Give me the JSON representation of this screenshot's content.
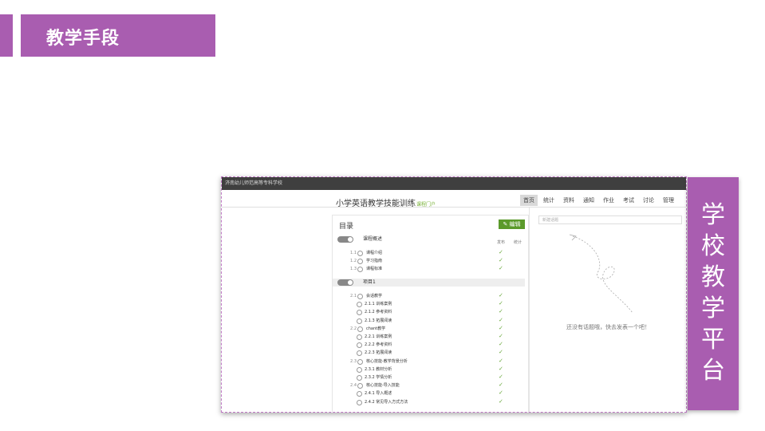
{
  "header": {
    "title": "教学手段"
  },
  "sidebar_card": {
    "text": "学\n校\n教\n学\n平\n台"
  },
  "screenshot": {
    "school": "济南幼儿师范高等专科学校",
    "course_title": "小学英语教学技能训练",
    "course_sub": "课程门户",
    "nav": [
      "首页",
      "统计",
      "资料",
      "通知",
      "作业",
      "考试",
      "讨论",
      "管理"
    ],
    "toc_title": "目录",
    "edit_label": "编辑",
    "col_study": "发布",
    "col_stat": "统计",
    "sections": [
      {
        "label": "课程概述"
      },
      {
        "label": "项目1"
      }
    ],
    "rows_sec1": [
      {
        "num": "1.1",
        "text": "课程介绍"
      },
      {
        "num": "1.2",
        "text": "学习指南"
      },
      {
        "num": "1.3",
        "text": "课程标准"
      }
    ],
    "rows_sec2": [
      {
        "num": "2.1",
        "text": "会话教学",
        "indent": 0
      },
      {
        "num": "",
        "text": "2.1.1 训练案例",
        "indent": 1
      },
      {
        "num": "",
        "text": "2.1.2 参考资料",
        "indent": 1
      },
      {
        "num": "",
        "text": "2.1.3 拓展阅读",
        "indent": 1
      },
      {
        "num": "2.2",
        "text": "chant教学",
        "indent": 0
      },
      {
        "num": "",
        "text": "2.2.1 训练案例",
        "indent": 1
      },
      {
        "num": "",
        "text": "2.2.2 参考资料",
        "indent": 1
      },
      {
        "num": "",
        "text": "2.2.3 拓展阅读",
        "indent": 1
      },
      {
        "num": "2.3",
        "text": "核心技能-教学背景分析",
        "indent": 0
      },
      {
        "num": "",
        "text": "2.3.1 教材分析",
        "indent": 1
      },
      {
        "num": "",
        "text": "2.3.2 学情分析",
        "indent": 1
      },
      {
        "num": "2.4",
        "text": "核心技能-导入技能",
        "indent": 0
      },
      {
        "num": "",
        "text": "2.4.1 导入概述",
        "indent": 1
      },
      {
        "num": "",
        "text": "2.4.2 常见导入方式方法",
        "indent": 1
      }
    ],
    "discuss_placeholder": "新建话题",
    "empty_text": "还没有话题哦，快去发表一个吧！"
  }
}
